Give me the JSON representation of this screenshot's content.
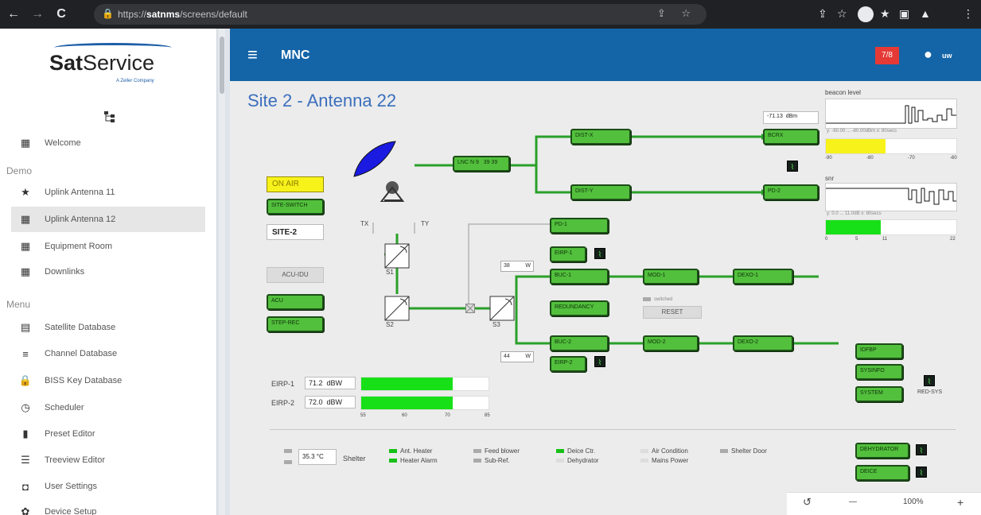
{
  "browser": {
    "url_prefix": "https://",
    "url_host": "satnms",
    "url_path": "/screens/default",
    "back": "←",
    "forward": "→",
    "reload": "C",
    "lock": "🔒",
    "url_icons": "⇪ ☆",
    "ext_icons": [
      "⇪",
      "☆",
      "★",
      "▣",
      "▲",
      "⋮"
    ]
  },
  "sidebar": {
    "logo": {
      "brand_bold": "Sat",
      "brand_rest": "Service",
      "tagline": "A Zeller Company"
    },
    "sections": {
      "demo": "Demo",
      "menu": "Menu"
    },
    "items": [
      {
        "label": "Welcome",
        "icon": "▦"
      },
      {
        "label": "Uplink Antenna 11",
        "icon": "★"
      },
      {
        "label": "Uplink Antenna 12",
        "icon": "▦"
      },
      {
        "label": "Equipment Room",
        "icon": "▦"
      },
      {
        "label": "Downlinks",
        "icon": "▦"
      },
      {
        "label": "Satellite Database",
        "icon": "▤"
      },
      {
        "label": "Channel Database",
        "icon": "≡"
      },
      {
        "label": "BISS Key Database",
        "icon": "🔒"
      },
      {
        "label": "Scheduler",
        "icon": "◷"
      },
      {
        "label": "Preset Editor",
        "icon": "▮"
      },
      {
        "label": "Treeview Editor",
        "icon": "☰"
      },
      {
        "label": "User Settings",
        "icon": "◘"
      },
      {
        "label": "Device Setup",
        "icon": "✿"
      }
    ]
  },
  "appbar": {
    "title": "MNC",
    "alarm_count": "7/8",
    "user": "uw",
    "menu_icon": "≡",
    "user_icon": "●"
  },
  "site": {
    "title": "Site 2 - Antenna 22"
  },
  "controls": {
    "on_air": "ON AIR",
    "site_switch": "SITE-SWITCH",
    "site_value": "SITE-2",
    "acu_idu": "ACU-IDU",
    "acu": "ACU",
    "step_rec": "STEP-REC"
  },
  "diagram": {
    "lnc": "LNC",
    "lnc_sub": "N 9   39 39",
    "tx": "TX",
    "ty": "TY",
    "switches": [
      "S1",
      "S2",
      "S3"
    ],
    "blocks": {
      "dist_x": "DIST-X",
      "dist_y": "DIST-Y",
      "bcrx": "BCRX",
      "pd_2": "PD-2",
      "pd_1": "PD-1",
      "eirp_1": "EIRP-1",
      "buc_1": "BUC-1",
      "mod_1": "MOD-1",
      "dexo_1": "DEXO-1",
      "redundancy": "REDUNDANCY",
      "buc_2": "BUC-2",
      "mod_2": "MOD-2",
      "dexo_2": "DEXO-2",
      "eirp_2": "EIRP-2"
    },
    "bcrx_level": "-71.13",
    "bcrx_unit": "dBm",
    "buc1_power": "38",
    "buc2_power": "44",
    "power_unit": "W",
    "switched_label": "switched",
    "reset": "RESET"
  },
  "right_panel": {
    "beacon_title": "beacon level",
    "beacon_caption": "y: -80.00 ... -80.00dBm  x: 80secs",
    "beacon_bar_ticks": [
      "-90",
      "-80",
      "-70",
      "-60"
    ],
    "beacon_level_fraction": 0.46,
    "snr_title": "snr",
    "snr_caption": "y: 0.0 ... 11.0dB  x: 80secs",
    "snr_bar_ticks": [
      "0",
      "5",
      "11",
      "22"
    ],
    "snr_level_fraction": 0.42,
    "idfbp": "IDFBP",
    "sysinfo": "SYSINFO",
    "system": "SYSTEM",
    "red_sys": "RED-SYS",
    "dehydrator": "DEHYDRATOR",
    "deice": "DEICE"
  },
  "eirp": {
    "rows": [
      {
        "label": "EIRP-1",
        "value": "71.2",
        "unit": "dBW",
        "fraction": 0.72
      },
      {
        "label": "EIRP-2",
        "value": "72.0",
        "unit": "dBW",
        "fraction": 0.72
      }
    ],
    "ticks": [
      "55",
      "60",
      "70",
      "85"
    ]
  },
  "status": {
    "temperature": "35.3 °C",
    "shelter": "Shelter",
    "items": [
      {
        "label": "Ant. Heater",
        "color": "#18c018"
      },
      {
        "label": "Heater Alarm",
        "color": "#18c018"
      },
      {
        "label": "Feed blower",
        "color": "#aaaaaa"
      },
      {
        "label": "Sub-Ref.",
        "color": "#aaaaaa"
      },
      {
        "label": "Deice Ctr.",
        "color": "#18c018"
      },
      {
        "label": "Dehydrator",
        "color": "#dddddd"
      },
      {
        "label": "Air Condition",
        "color": "#dddddd"
      },
      {
        "label": "Mains Power",
        "color": "#dddddd"
      },
      {
        "label": "Shelter Door",
        "color": "#aaaaaa"
      }
    ]
  },
  "zoom": {
    "history_icon": "↺",
    "minus": "—",
    "level": "100%",
    "plus": "+"
  }
}
